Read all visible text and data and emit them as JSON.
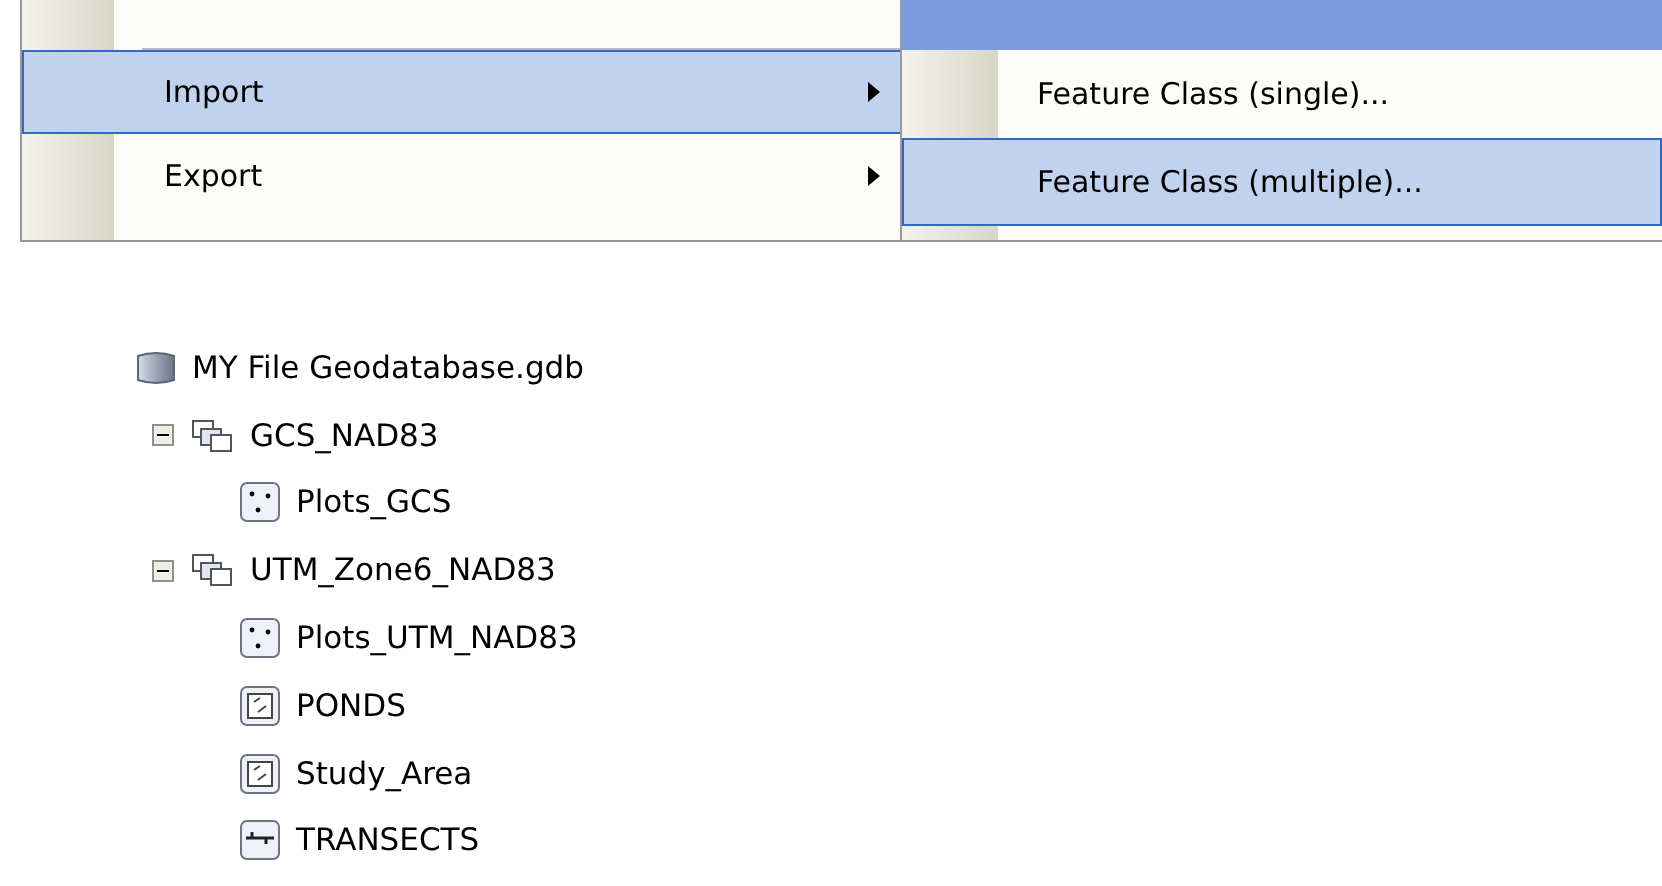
{
  "menu": {
    "items": [
      {
        "label": "Import",
        "selected": true,
        "has_submenu": true
      },
      {
        "label": "Export",
        "selected": false,
        "has_submenu": true
      }
    ]
  },
  "submenu": {
    "items": [
      {
        "label": "Feature Class (single)...",
        "selected": false
      },
      {
        "label": "Feature Class (multiple)...",
        "selected": true
      }
    ]
  },
  "tree": {
    "root": {
      "label": "MY File Geodatabase.gdb",
      "kind": "geodatabase",
      "children": [
        {
          "label": "GCS_NAD83",
          "kind": "dataset",
          "expanded": true,
          "children": [
            {
              "label": "Plots_GCS",
              "kind": "point"
            }
          ]
        },
        {
          "label": "UTM_Zone6_NAD83",
          "kind": "dataset",
          "expanded": true,
          "children": [
            {
              "label": "Plots_UTM_NAD83",
              "kind": "point"
            },
            {
              "label": "PONDS",
              "kind": "polygon"
            },
            {
              "label": "Study_Area",
              "kind": "polygon"
            },
            {
              "label": "TRANSECTS",
              "kind": "line"
            }
          ]
        }
      ]
    }
  }
}
